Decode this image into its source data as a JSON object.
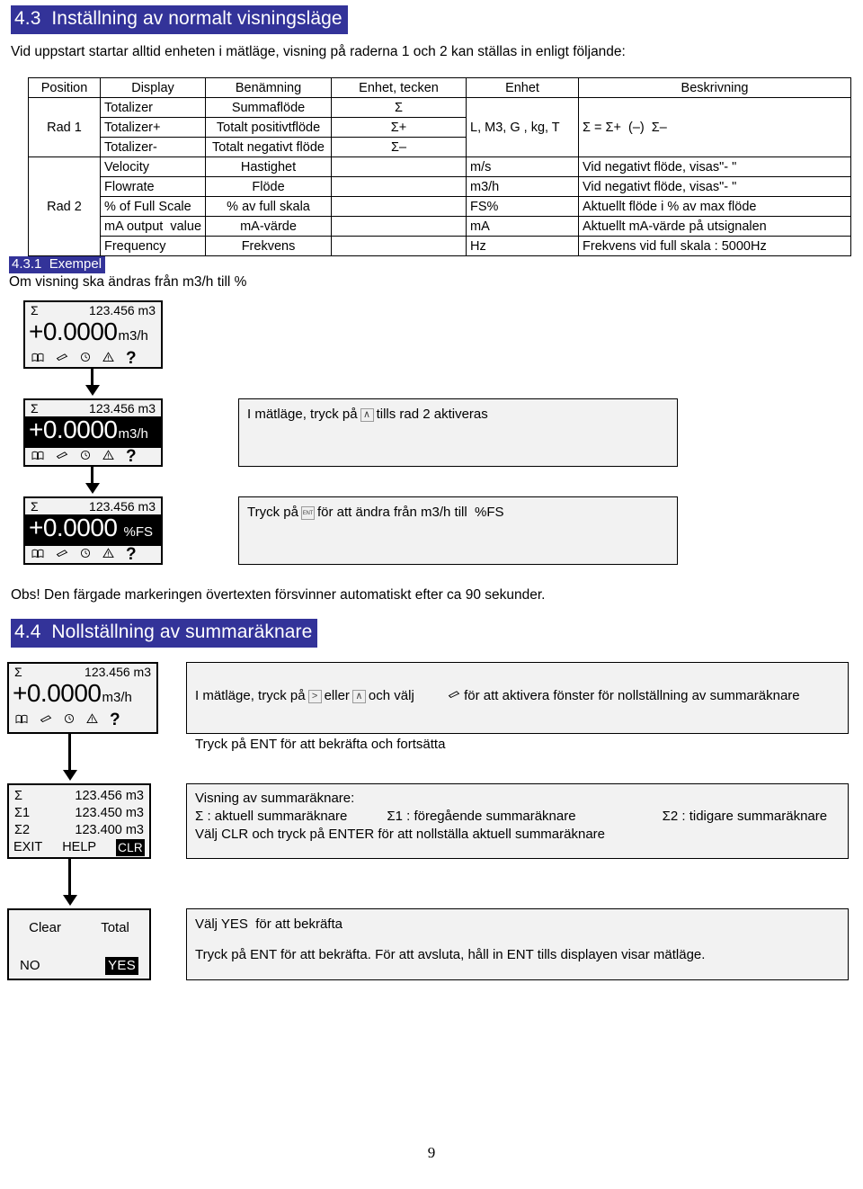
{
  "document": {
    "page_number": "9",
    "section_43": {
      "heading": "4.3  Inställning av normalt visningsläge",
      "intro": "Vid uppstart startar alltid enheten i mätläge, visning på raderna 1 och 2 kan ställas in enligt följande:"
    },
    "section_431": {
      "heading": "4.3.1  Exempel",
      "intro": "Om visning ska ändras från m3/h till %"
    },
    "obs_note": "Obs! Den färgade markeringen övertexten försvinner automatiskt efter ca 90 sekunder.",
    "section_44": {
      "heading": "4.4  Nollställning av summaräknare"
    }
  },
  "table": {
    "headers": [
      "Position",
      "Display",
      "Benämning",
      "Enhet, tecken",
      "Enhet",
      "Beskrivning"
    ],
    "groups": [
      {
        "position": "Rad 1",
        "unit": "L, M3, G , kg, T",
        "description": "Σ = Σ+  (–)  Σ–",
        "rows": [
          {
            "display": "Totalizer",
            "name": "Summaflöde",
            "symbol": "Σ"
          },
          {
            "display": "Totalizer+",
            "name": "Totalt positivtflöde",
            "symbol": "Σ+"
          },
          {
            "display": "Totalizer-",
            "name": "Totalt negativt flöde",
            "symbol": "Σ–"
          }
        ]
      },
      {
        "position": "Rad 2",
        "rows": [
          {
            "display": "Velocity",
            "name": "Hastighet",
            "symbol": "",
            "unit": "m/s",
            "description": "Vid negativt flöde, visas\"- \""
          },
          {
            "display": "Flowrate",
            "name": "Flöde",
            "symbol": "",
            "unit": "m3/h",
            "description": "Vid negativt flöde, visas\"- \""
          },
          {
            "display": "% of Full Scale",
            "name": "% av full skala",
            "symbol": "",
            "unit": "FS%",
            "description": "Aktuellt flöde i % av max flöde"
          },
          {
            "display": "mA output  value",
            "name": "mA-värde",
            "symbol": "",
            "unit": "mA",
            "description": "Aktuellt mA-värde på utsignalen"
          },
          {
            "display": "Frequency",
            "name": "Frekvens",
            "symbol": "",
            "unit": "Hz",
            "description": "Frekvens vid full skala : 5000Hz"
          }
        ]
      }
    ]
  },
  "panels": {
    "p1": {
      "row1_left": "Σ",
      "row1_right": "123.456 m3",
      "value": "+0.0000",
      "unit": "m3/h",
      "inverted": false,
      "icons": [
        "book-icon",
        "eraser-icon",
        "clock-icon",
        "warning-icon",
        "question-icon"
      ],
      "question_glyph": "?"
    },
    "p2": {
      "row1_left": "Σ",
      "row1_right": "123.456 m3",
      "value": "+0.0000",
      "unit": "m3/h",
      "inverted": true,
      "question_glyph": "?"
    },
    "p3": {
      "row1_left": "Σ",
      "row1_right": "123.456 m3",
      "value": "+0.0000",
      "unit": "%FS",
      "inverted": true,
      "question_glyph": "?"
    },
    "p4": {
      "row1_left": "Σ",
      "row1_right": "123.456 m3",
      "value": "+0.0000",
      "unit": "m3/h",
      "inverted": false,
      "question_glyph": "?"
    },
    "p5": {
      "rows": [
        {
          "label": "Σ",
          "value": "123.456 m3"
        },
        {
          "label": "Σ1",
          "value": "123.450 m3"
        },
        {
          "label": "Σ2",
          "value": "123.400 m3"
        }
      ],
      "softkeys": {
        "exit": "EXIT",
        "help": "HELP",
        "clr": "CLR"
      }
    },
    "p6": {
      "title_left": "Clear",
      "title_right": "Total",
      "option_no": "NO",
      "option_yes": "YES"
    }
  },
  "notes": {
    "n1": {
      "pre": "I mätläge, tryck på",
      "key": "∧",
      "post": "tills rad 2 aktiveras"
    },
    "n2": {
      "pre": "Tryck på",
      "key": "ENT",
      "post": "för att ändra från m3/h till  %FS"
    },
    "n3": {
      "line1_a": "I mätläge, tryck på",
      "key1": ">",
      "line1_b": "eller",
      "key2": "∧",
      "line1_c": "och välj",
      "line1_d": "för att aktivera fönster för nollställning av summaräknare",
      "line2": "Tryck på ENT för att bekräfta och fortsätta"
    },
    "n4": {
      "line1": "Visning av summaräknare:",
      "line2_a": "Σ : aktuell summaräknare",
      "line2_b": "Σ1 : föregående summaräknare",
      "line2_c": "Σ2 : tidigare summaräknare",
      "line3": "Välj CLR och tryck på ENTER för att nollställa aktuell summaräknare"
    },
    "n5": {
      "line1": "Välj YES  för att bekräfta",
      "line2": "Tryck på ENT för att bekräfta. För att avsluta, håll in ENT tills displayen visar mätläge."
    }
  },
  "colors": {
    "heading_bg": "#333399",
    "heading_fg": "#ffffff",
    "panel_bg": "#f2f2f2",
    "inverted_bg": "#000000"
  }
}
